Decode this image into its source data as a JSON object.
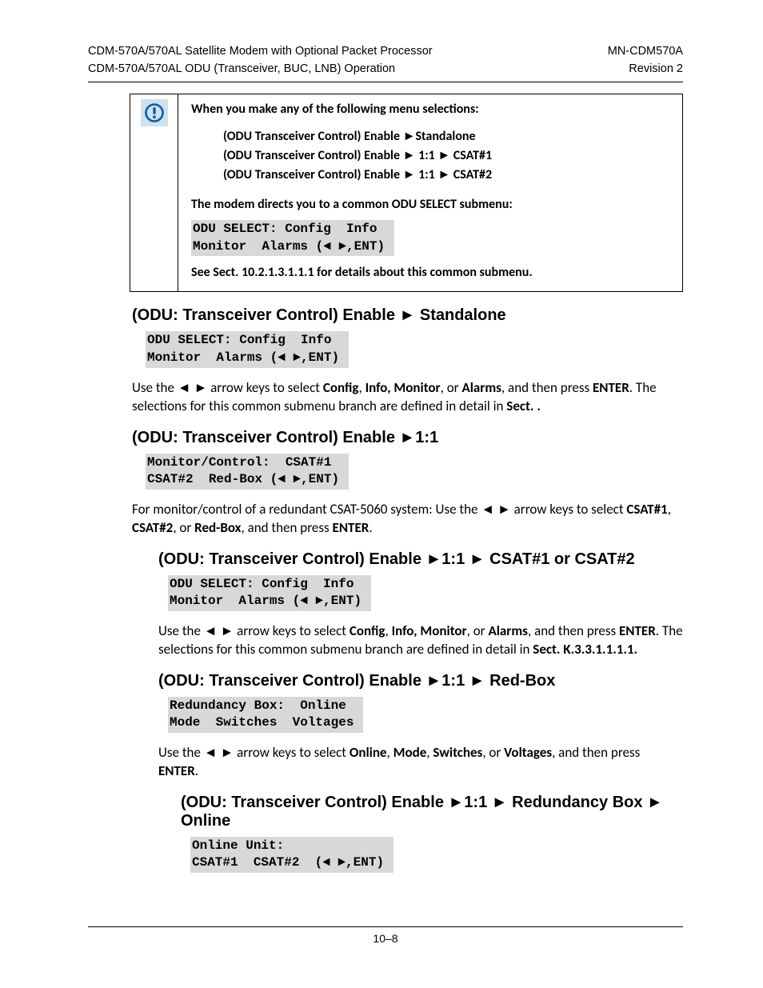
{
  "header": {
    "l1": "CDM-570A/570AL Satellite Modem with Optional Packet Processor",
    "l2": "CDM-570A/570AL ODU (Transceiver, BUC, LNB) Operation",
    "r1": "MN-CDM570A",
    "r2": "Revision 2"
  },
  "notice": {
    "icon": "alert-circle-icon",
    "lead": "When you make any of the following menu selections:",
    "lines": [
      "(ODU Transceiver Control) Enable ►Standalone",
      "(ODU Transceiver Control) Enable ► 1:1 ► CSAT#1",
      "(ODU Transceiver Control) Enable ► 1:1 ► CSAT#2"
    ],
    "mid": "The modem directs you to a common ODU SELECT submenu:",
    "code": "ODU SELECT: Config  Info \nMonitor  Alarms (◄ ►,ENT) ",
    "ref": "See Sect. 10.2.1.3.1.1.1 for details about this common submenu."
  },
  "s1": {
    "title": "(ODU: Transceiver Control) Enable ► Standalone",
    "code": "ODU SELECT: Config  Info \nMonitor  Alarms (◄ ►,ENT) ",
    "p_a": "Use the ◄ ► arrow keys to select ",
    "p_b": "Config",
    "p_c": ", ",
    "p_d": "Info, Monitor",
    "p_e": ", or ",
    "p_f": "Alarms",
    "p_g": ", and then press ",
    "p_h": "ENTER",
    "p_i": ". The selections for this common submenu branch are defined in detail in ",
    "p_j": "Sect. .",
    "p_k": ""
  },
  "s2": {
    "title": "(ODU: Transceiver Control) Enable ►1:1",
    "code": "Monitor/Control:  CSAT#1 \nCSAT#2  Red-Box (◄ ►,ENT) ",
    "p_a": "For monitor/control of a redundant CSAT-5060 system: Use the ◄ ► arrow keys to select ",
    "p_b": "CSAT#1",
    "p_c": ", ",
    "p_d": "CSAT#2",
    "p_e": ", or ",
    "p_f": "Red-Box",
    "p_g": ", and then press ",
    "p_h": "ENTER",
    "p_i": ".",
    "p_j": "",
    "p_k": ""
  },
  "s3": {
    "title": "(ODU: Transceiver Control) Enable ►1:1 ► CSAT#1 or CSAT#2",
    "code": "ODU SELECT: Config  Info \nMonitor  Alarms (◄ ►,ENT) ",
    "p_a": "Use the ◄ ► arrow keys to select ",
    "p_b": "Config",
    "p_c": ", ",
    "p_d": "Info, Monitor",
    "p_e": ", or ",
    "p_f": "Alarms",
    "p_g": ", and then press ",
    "p_h": "ENTER",
    "p_i": ". The selections for this common submenu branch are defined in detail in ",
    "p_j": "Sect. K.3.3.1.1.1.1.",
    "p_k": ""
  },
  "s4": {
    "title": "(ODU: Transceiver Control) Enable ►1:1 ► Red-Box",
    "code": "Redundancy Box:  Online \nMode  Switches  Voltages ",
    "p_a": "Use the ◄ ► arrow keys to select ",
    "p_b": "Online",
    "p_c": ", ",
    "p_d": "Mode",
    "p_e": ", ",
    "p_f": "Switches",
    "p_g": ", or ",
    "p_h": "Voltages",
    "p_i": ", and then press ",
    "p_j": "ENTER",
    "p_k": "."
  },
  "s5": {
    "title": "(ODU: Transceiver Control) Enable ►1:1 ► Redundancy Box ► Online",
    "code": "Online Unit:             \nCSAT#1  CSAT#2  (◄ ►,ENT) "
  },
  "footer": {
    "page": "10–8"
  }
}
